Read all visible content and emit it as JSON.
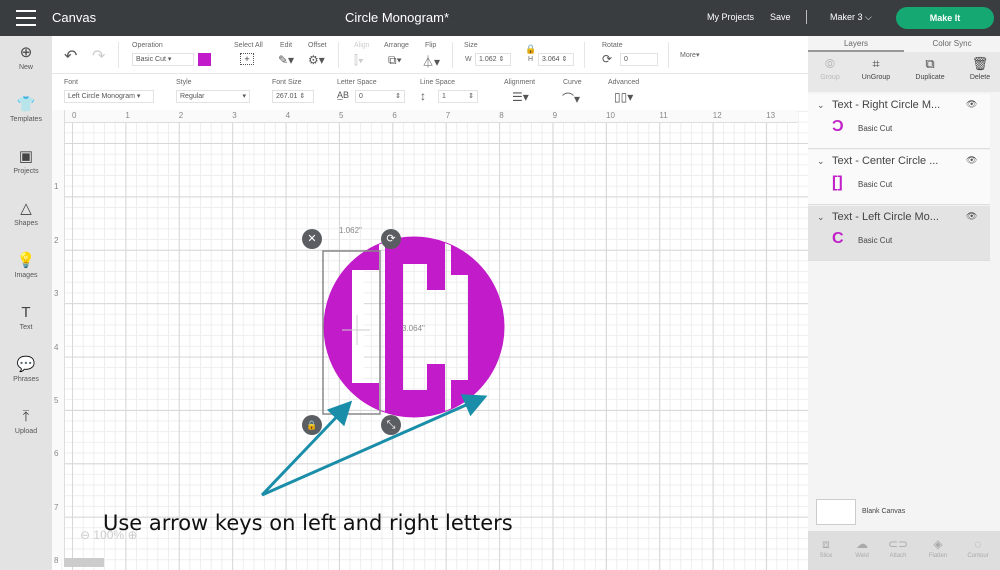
{
  "topbar": {
    "app": "Canvas",
    "title": "Circle Monogram*",
    "my_projects": "My Projects",
    "save": "Save",
    "machine": "Maker 3",
    "machine_chevron": "⌵",
    "make_it": "Make It"
  },
  "leftnav": [
    {
      "label": "New",
      "icon": "⊕"
    },
    {
      "label": "Templates",
      "icon": "👕"
    },
    {
      "label": "Projects",
      "icon": "▣"
    },
    {
      "label": "Shapes",
      "icon": "△"
    },
    {
      "label": "Images",
      "icon": "💡"
    },
    {
      "label": "Text",
      "icon": "T"
    },
    {
      "label": "Phrases",
      "icon": "💬"
    },
    {
      "label": "Upload",
      "icon": "⤒"
    }
  ],
  "toolbar1": {
    "undo": "↶",
    "redo": "↷",
    "operation_label": "Operation",
    "operation_value": "Basic Cut",
    "operation_color": "#c21bc9",
    "select_all": "Select All",
    "edit": "Edit",
    "offset": "Offset",
    "align": "Align",
    "arrange": "Arrange",
    "flip": "Flip",
    "size": "Size",
    "w_label": "W",
    "w_value": "1.062",
    "h_label": "H",
    "h_value": "3.064",
    "rotate": "Rotate",
    "rotate_value": "0",
    "more": "More▾"
  },
  "toolbar2": {
    "font_label": "Font",
    "font_value": "Left Circle Monogram ▾",
    "style_label": "Style",
    "style_value": "Regular",
    "fontsize_label": "Font Size",
    "fontsize_value": "267.01",
    "letter_label": "Letter Space",
    "letter_value": "0",
    "line_label": "Line Space",
    "line_value": "1",
    "alignment_label": "Alignment",
    "curve_label": "Curve",
    "advanced_label": "Advanced"
  },
  "ruler_h": [
    "0",
    "1",
    "2",
    "3",
    "4",
    "5",
    "6",
    "7",
    "8",
    "9",
    "10",
    "11",
    "12",
    "13"
  ],
  "ruler_v": [
    "1",
    "2",
    "3",
    "4",
    "5",
    "6",
    "7",
    "8"
  ],
  "selection": {
    "width_label": "1.062\"",
    "height_label": "3.064\""
  },
  "annotation": "Use arrow keys on left and right letters",
  "zoom": {
    "value": "100%"
  },
  "rightpanel": {
    "tabs": [
      "Layers",
      "Color Sync"
    ],
    "tools": [
      "Group",
      "UnGroup",
      "Duplicate",
      "Delete"
    ],
    "layers": [
      {
        "name": "Text - Right Circle M...",
        "op": "Basic Cut",
        "thumb": "Ɔ"
      },
      {
        "name": "Text - Center Circle ...",
        "op": "Basic Cut",
        "thumb": "[]"
      },
      {
        "name": "Text - Left Circle Mo...",
        "op": "Basic Cut",
        "thumb": "C"
      }
    ],
    "blank_canvas": "Blank Canvas",
    "bottom_tools": [
      "Slice",
      "Weld",
      "Attach",
      "Flatten",
      "Contour"
    ]
  }
}
